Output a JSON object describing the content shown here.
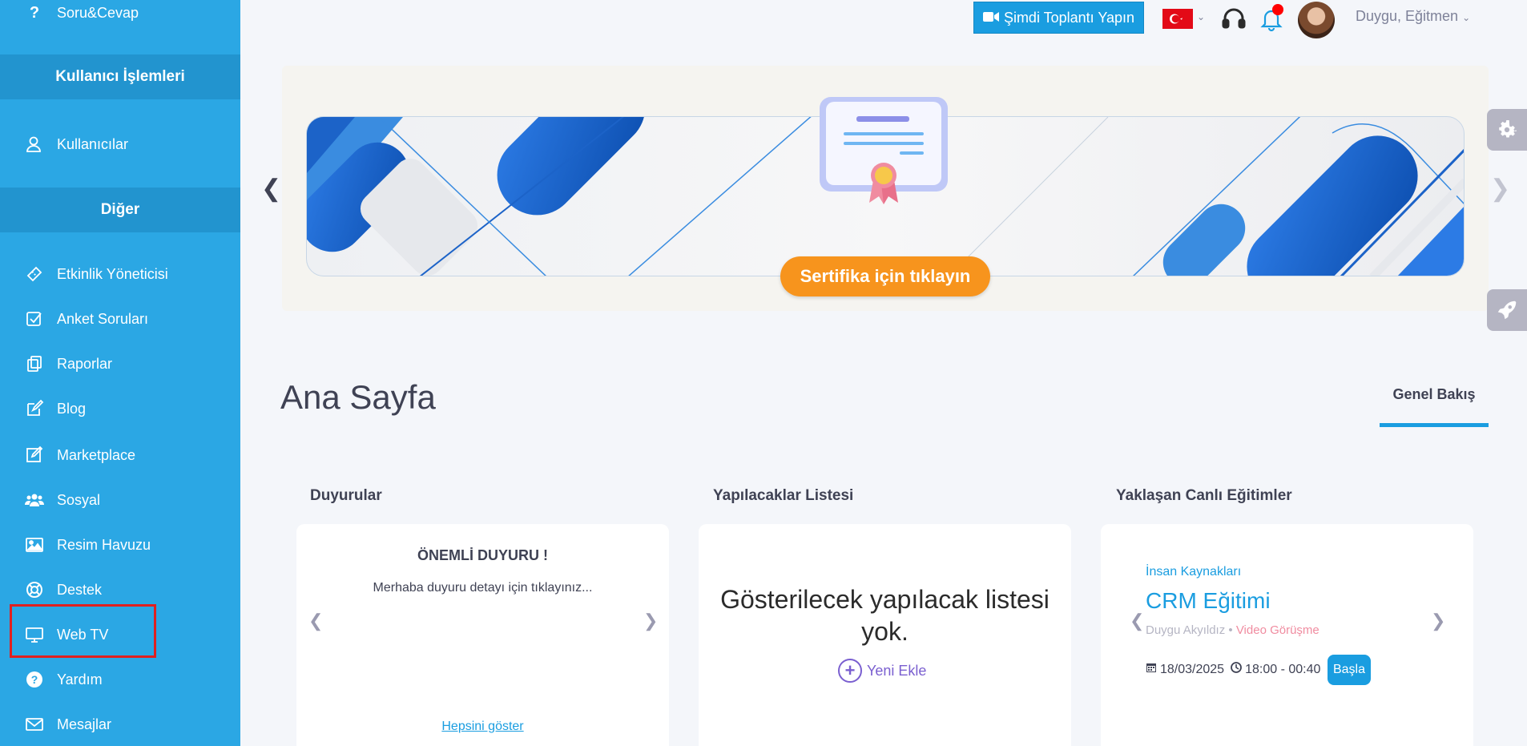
{
  "sidebar": {
    "top_item": "Soru&Cevap",
    "section_user": "Kullanıcı İşlemleri",
    "users": "Kullanıcılar",
    "section_other": "Diğer",
    "items": [
      {
        "label": "Etkinlik Yöneticisi",
        "icon": "ticket-icon"
      },
      {
        "label": "Anket Soruları",
        "icon": "checkbox-icon"
      },
      {
        "label": "Raporlar",
        "icon": "copy-icon"
      },
      {
        "label": "Blog",
        "icon": "edit-icon"
      },
      {
        "label": "Marketplace",
        "icon": "edit-square-icon"
      },
      {
        "label": "Sosyal",
        "icon": "group-icon"
      },
      {
        "label": "Resim Havuzu",
        "icon": "image-icon"
      },
      {
        "label": "Destek",
        "icon": "life-ring-icon"
      },
      {
        "label": "Web TV",
        "icon": "monitor-icon"
      },
      {
        "label": "Yardım",
        "icon": "question-circle-icon"
      },
      {
        "label": "Mesajlar",
        "icon": "envelope-icon"
      }
    ]
  },
  "topbar": {
    "meeting_button": "Şimdi Toplantı Yapın",
    "user_name": "Duygu, Eğitmen"
  },
  "banner": {
    "button_label": "Sertifika için tıklayın"
  },
  "page": {
    "title": "Ana Sayfa",
    "tab": "Genel Bakış"
  },
  "announcements": {
    "title": "Duyurular",
    "item_title": "ÖNEMLİ DUYURU !",
    "item_text": "Merhaba duyuru detayı için tıklayınız...",
    "show_all": "Hepsini göster"
  },
  "todo": {
    "title": "Yapılacaklar Listesi",
    "empty_text": "Gösterilecek yapılacak listesi yok.",
    "add_label": "Yeni Ekle"
  },
  "events": {
    "title": "Yaklaşan Canlı Eğitimler",
    "category": "İnsan Kaynakları",
    "name": "CRM Eğitimi",
    "instructor": "Duygu Akyıldız",
    "separator": " • ",
    "type": "Video Görüşme",
    "date": "18/03/2025",
    "time": "18:00 - 00:40",
    "start_label": "Başla"
  },
  "colors": {
    "sidebar": "#2ba7e4",
    "accent": "#1a9de0",
    "cert_button": "#f7941d"
  }
}
